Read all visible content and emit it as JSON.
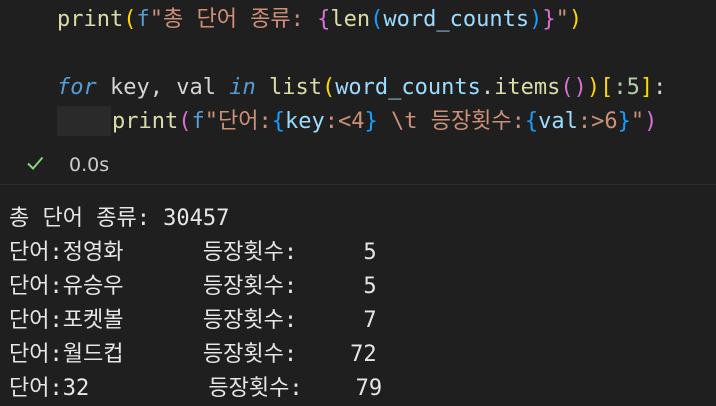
{
  "code": {
    "line1": {
      "fn": "print",
      "paren_open": "(",
      "prefix": "f",
      "str_start": "\"총 단어 종류: ",
      "brace_open": "{",
      "len": "len",
      "inner_open": "(",
      "var": "word_counts",
      "inner_close": ")",
      "brace_close": "}",
      "str_end": "\"",
      "paren_close": ")"
    },
    "line2": {
      "for": "for",
      "vars": " key, val ",
      "in": "in",
      "sp": " ",
      "list": "list",
      "p1": "(",
      "wc": "word_counts",
      "dot": ".",
      "items": "items",
      "p2": "()",
      "p3": ")",
      "slice_open": "[",
      "slice_inner": ":5",
      "slice_close": "]",
      "colon": ":"
    },
    "line3": {
      "fn": "print",
      "paren_open": "(",
      "prefix": "f",
      "s1": "\"단어:",
      "b1o": "{",
      "key": "key",
      "fmt1": ":<4",
      "b1c": "}",
      "s2": " \\t 등장횟수:",
      "b2o": "{",
      "val": "val",
      "fmt2": ":>6",
      "b2c": "}",
      "s3": "\"",
      "paren_close": ")"
    }
  },
  "status": {
    "check_icon": "check-icon",
    "time": "0.0s",
    "success_color": "#89d185"
  },
  "output": {
    "lines": [
      "총 단어 종류: 30457",
      "단어:정영화      등장횟수:     5",
      "단어:유승우      등장횟수:     5",
      "단어:포켓볼      등장횟수:     7",
      "단어:월드컵      등장횟수:    72",
      "단어:32         등장횟수:    79"
    ]
  }
}
